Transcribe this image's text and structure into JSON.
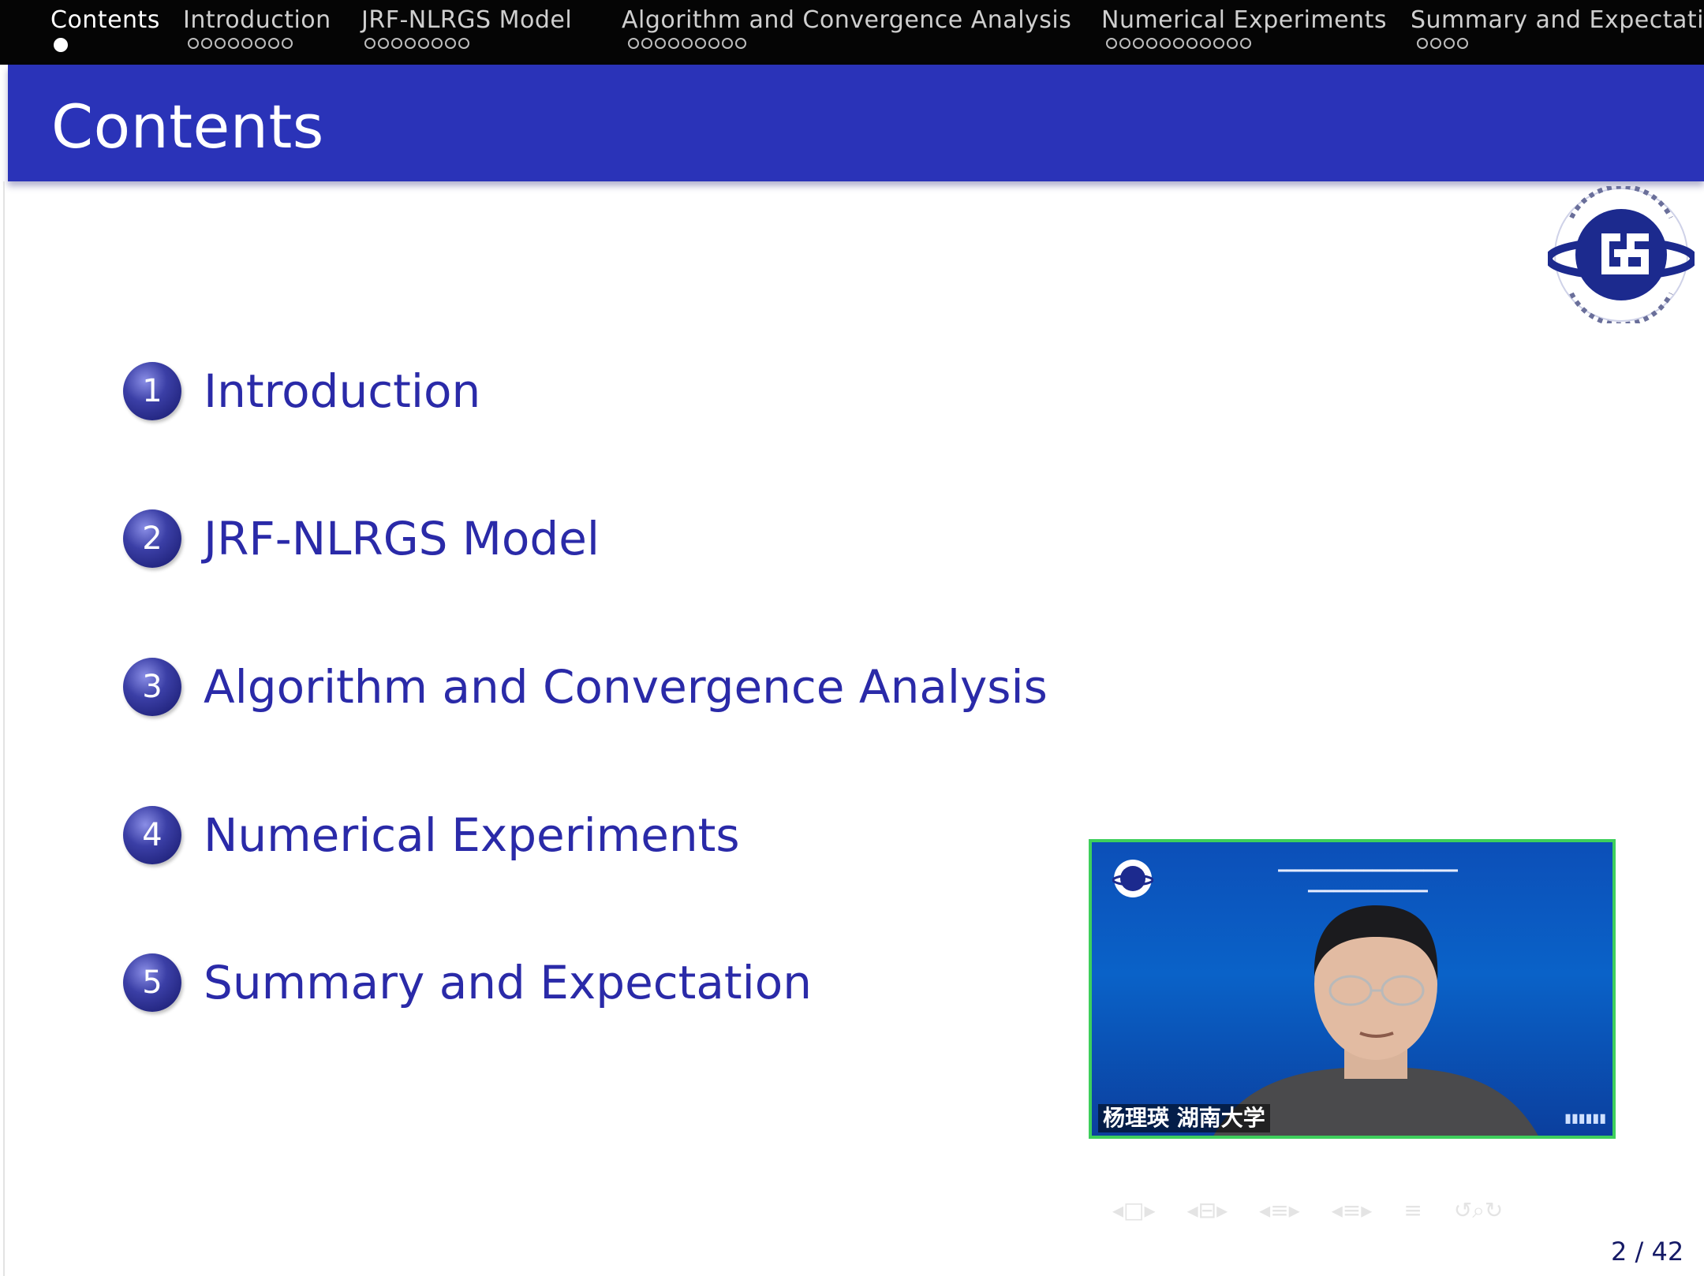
{
  "headline": {
    "sections": [
      {
        "title": "Contents",
        "dots": 1,
        "active": true
      },
      {
        "title": "Introduction",
        "dots": 8,
        "active": false
      },
      {
        "title": "JRF-NLRGS Model",
        "dots": 8,
        "active": false
      },
      {
        "title": "Algorithm and Convergence Analysis",
        "dots": 9,
        "active": false
      },
      {
        "title": "Numerical Experiments",
        "dots": 11,
        "active": false
      },
      {
        "title": "Summary and Expectation",
        "dots": 4,
        "active": false
      }
    ]
  },
  "frame": {
    "title": "Contents"
  },
  "toc": [
    {
      "number": "1",
      "label": "Introduction"
    },
    {
      "number": "2",
      "label": "JRF-NLRGS Model"
    },
    {
      "number": "3",
      "label": "Algorithm and Convergence Analysis"
    },
    {
      "number": "4",
      "label": "Numerical Experiments"
    },
    {
      "number": "5",
      "label": "Summary and Expectation"
    }
  ],
  "webcam": {
    "caption": "杨理瑛 湖南大学"
  },
  "footer": {
    "page": "2 / 42"
  },
  "colors": {
    "headline_bg": "#050505",
    "frametitle_bg": "#2a33b8",
    "toc_text": "#2a2aa8",
    "webcam_border": "#3ecf5c"
  },
  "icons": {
    "logo": "gs-society-logo",
    "navsymbols": [
      "nav-slide-icon",
      "nav-frame-icon",
      "nav-subsection-icon",
      "nav-section-icon",
      "nav-doc-icon",
      "nav-search-icon"
    ]
  }
}
